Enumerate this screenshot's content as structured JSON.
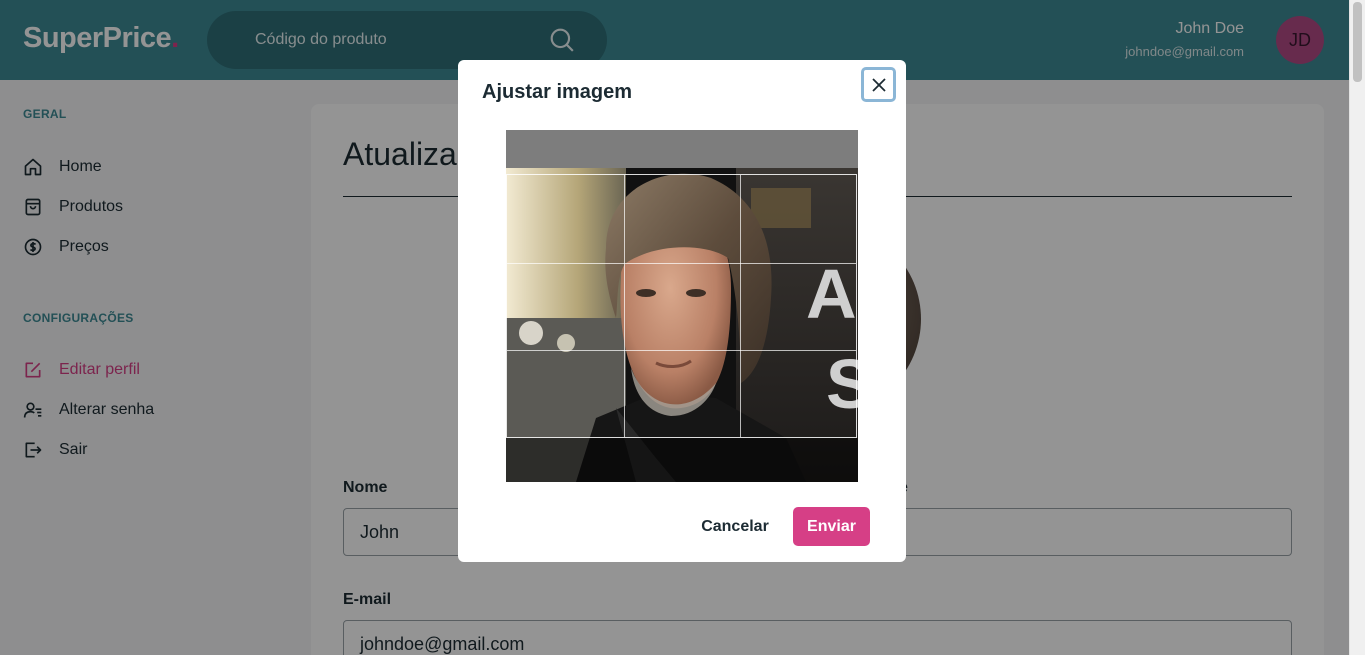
{
  "header": {
    "logo": "SuperPrice",
    "logo_dot": ".",
    "search_placeholder": "Código do produto",
    "user_name": "John Doe",
    "user_email": "johndoe@gmail.com",
    "avatar_initials": "JD"
  },
  "sidebar": {
    "section_general": "GERAL",
    "general_items": [
      {
        "label": "Home",
        "icon": "home-icon"
      },
      {
        "label": "Produtos",
        "icon": "bag-icon"
      },
      {
        "label": "Preços",
        "icon": "dollar-icon"
      }
    ],
    "section_settings": "CONFIGURAÇÕES",
    "settings_items": [
      {
        "label": "Editar perfil",
        "icon": "edit-icon",
        "active": true
      },
      {
        "label": "Alterar senha",
        "icon": "user-lines-icon"
      },
      {
        "label": "Sair",
        "icon": "logout-icon"
      }
    ]
  },
  "main": {
    "title_visible": "Atualizar",
    "name_label": "Nome",
    "name_value": "John",
    "lastname_label_partial": "e",
    "email_label": "E-mail",
    "email_value": "johndoe@gmail.com"
  },
  "modal": {
    "title": "Ajustar imagem",
    "cancel_label": "Cancelar",
    "send_label": "Enviar"
  },
  "colors": {
    "brand_teal": "#3d8a94",
    "accent_pink": "#d63f86",
    "text_dark": "#1c2b33"
  }
}
